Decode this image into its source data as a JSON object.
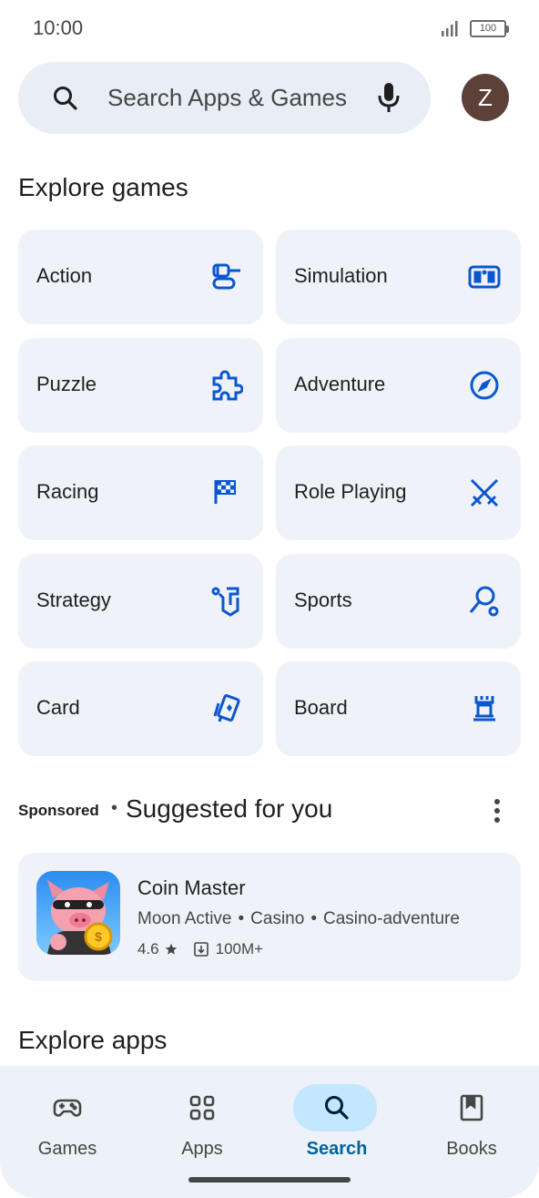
{
  "status_bar": {
    "time": "10:00",
    "battery": "100"
  },
  "search": {
    "placeholder": "Search Apps & Games",
    "avatar_initial": "Z"
  },
  "explore_games": {
    "title": "Explore games",
    "categories": [
      {
        "label": "Action",
        "icon": "tank-icon"
      },
      {
        "label": "Simulation",
        "icon": "vr-headset-icon"
      },
      {
        "label": "Puzzle",
        "icon": "puzzle-piece-icon"
      },
      {
        "label": "Adventure",
        "icon": "compass-icon"
      },
      {
        "label": "Racing",
        "icon": "checkered-flag-icon"
      },
      {
        "label": "Role Playing",
        "icon": "crossed-swords-icon"
      },
      {
        "label": "Strategy",
        "icon": "chess-piece-icon"
      },
      {
        "label": "Sports",
        "icon": "racket-icon"
      },
      {
        "label": "Card",
        "icon": "cards-icon"
      },
      {
        "label": "Board",
        "icon": "rook-icon"
      }
    ]
  },
  "suggested": {
    "sponsored_label": "Sponsored",
    "separator": "•",
    "title": "Suggested for you",
    "app": {
      "name": "Coin Master",
      "developer": "Moon Active",
      "category": "Casino",
      "subcategory": "Casino-adventure",
      "rating": "4.6",
      "downloads": "100M+"
    }
  },
  "explore_apps": {
    "title": "Explore apps"
  },
  "bottom_nav": {
    "items": [
      {
        "label": "Games",
        "icon": "gamepad-icon",
        "active": false
      },
      {
        "label": "Apps",
        "icon": "apps-grid-icon",
        "active": false
      },
      {
        "label": "Search",
        "icon": "search-icon",
        "active": true
      },
      {
        "label": "Books",
        "icon": "book-icon",
        "active": false
      }
    ]
  },
  "colors": {
    "accent": "#0b57d0",
    "card_bg": "#eff3f9",
    "search_bg": "#e9eef6",
    "active_pill": "#c2e7ff"
  }
}
